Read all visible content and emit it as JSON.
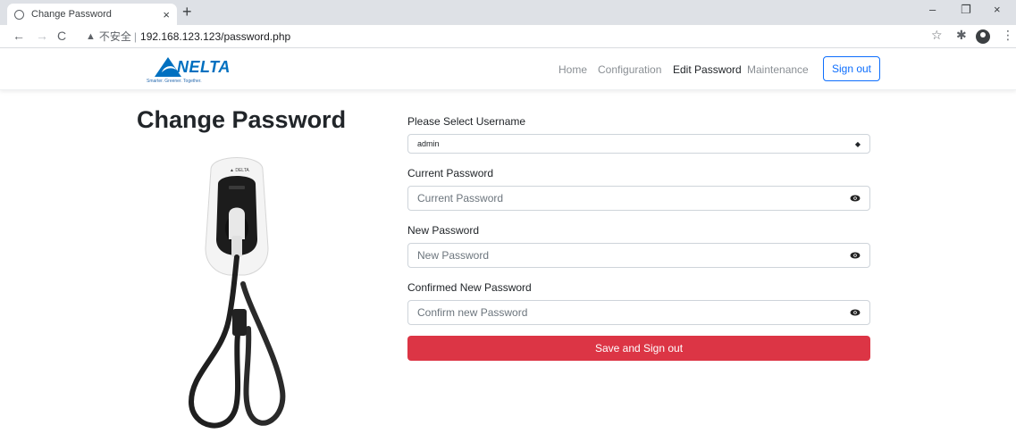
{
  "browser": {
    "tab_title": "Change Password",
    "tab_close": "×",
    "new_tab": "+",
    "insecure_label": "不安全",
    "separator": "|",
    "url": "192.168.123.123/password.php",
    "window_controls": {
      "minimize": "–",
      "restore": "❐",
      "close": "×"
    },
    "toolbar_icons": {
      "star": "☆",
      "extensions": "✱",
      "menu": "⋮"
    }
  },
  "site": {
    "logo": {
      "word": "NELTA",
      "tagline": "Smarter.  Greener.  Together.",
      "brand_color": "#0070c0"
    },
    "nav": {
      "home": "Home",
      "configuration": "Configuration",
      "edit_password": "Edit Password",
      "maintenance": "Maintenance",
      "sign_out": "Sign out"
    }
  },
  "page": {
    "title": "Change Password"
  },
  "form": {
    "username_label": "Please Select Username",
    "username_value": "admin",
    "current_label": "Current Password",
    "current_placeholder": "Current Password",
    "new_label": "New Password",
    "new_placeholder": "New Password",
    "confirm_label": "Confirmed New Password",
    "confirm_placeholder": "Confirm new Password",
    "submit_label": "Save and Sign out",
    "submit_color": "#dc3545"
  }
}
